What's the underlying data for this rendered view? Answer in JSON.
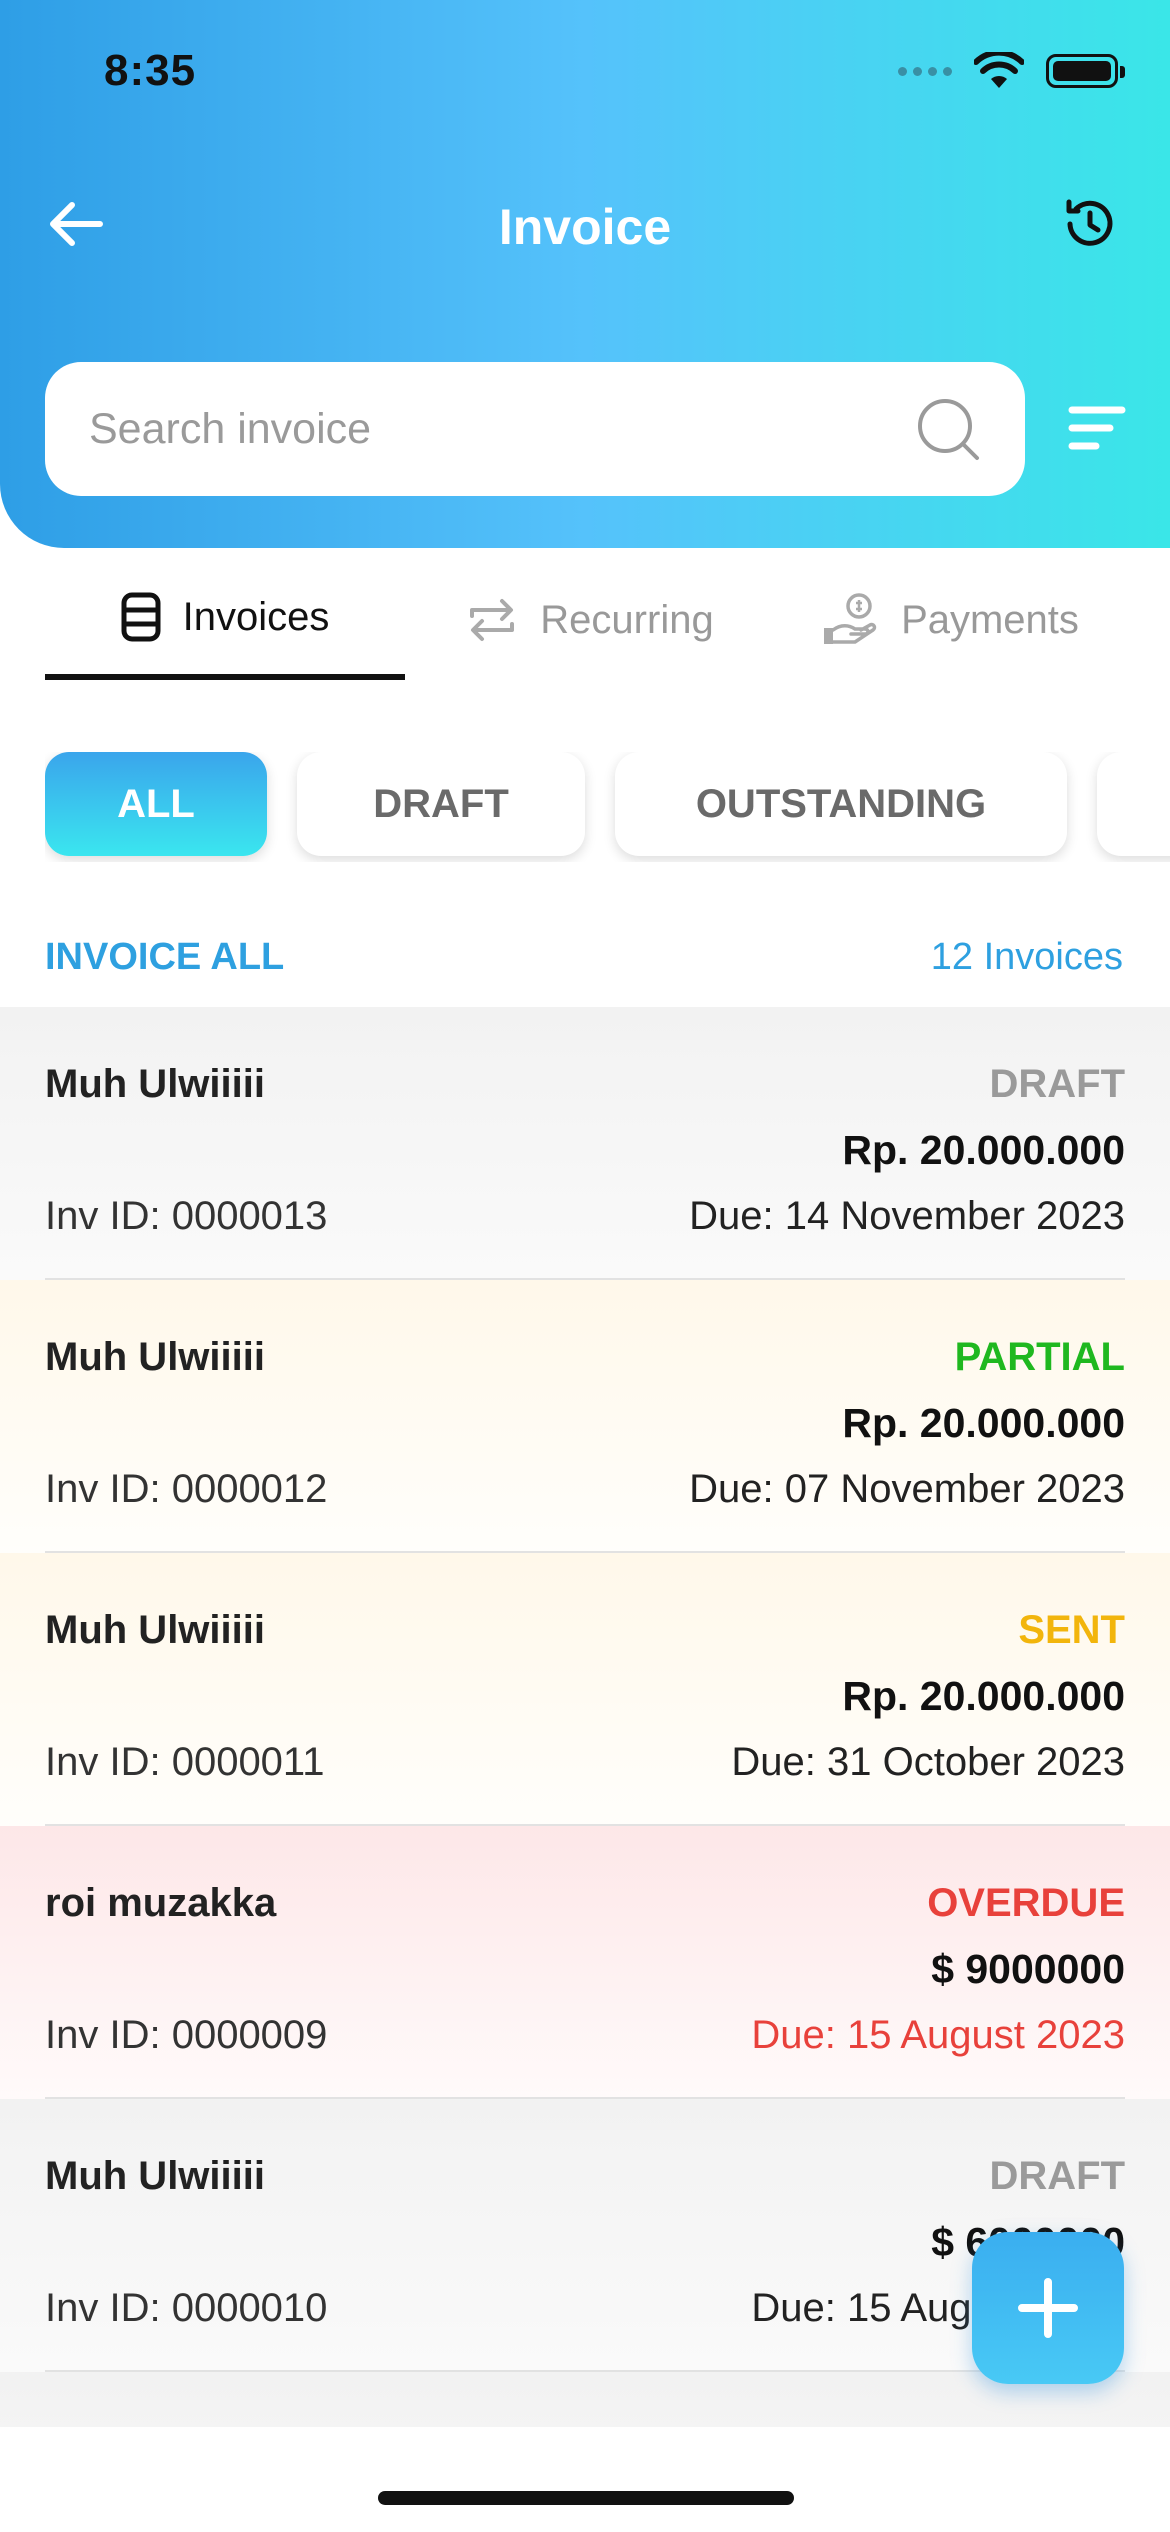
{
  "status_bar": {
    "time": "8:35"
  },
  "header": {
    "title": "Invoice"
  },
  "search": {
    "placeholder": "Search invoice"
  },
  "tabs": [
    {
      "label": "Invoices",
      "icon": "database-icon",
      "active": true
    },
    {
      "label": "Recurring",
      "icon": "repeat-icon",
      "active": false
    },
    {
      "label": "Payments",
      "icon": "hand-coin-icon",
      "active": false
    }
  ],
  "filters": [
    {
      "label": "ALL",
      "active": true
    },
    {
      "label": "DRAFT",
      "active": false
    },
    {
      "label": "OUTSTANDING",
      "active": false
    }
  ],
  "section": {
    "title": "INVOICE ALL",
    "count": "12 Invoices"
  },
  "invoices": [
    {
      "client": "Muh Ulwiiiii",
      "status": "DRAFT",
      "amount": "Rp. 20.000.000",
      "inv_id": "Inv ID: 0000013",
      "due": "Due: 14 November 2023"
    },
    {
      "client": "Muh Ulwiiiii",
      "status": "PARTIAL",
      "amount": "Rp. 20.000.000",
      "inv_id": "Inv ID: 0000012",
      "due": "Due: 07 November 2023"
    },
    {
      "client": "Muh Ulwiiiii",
      "status": "SENT",
      "amount": "Rp. 20.000.000",
      "inv_id": "Inv ID: 0000011",
      "due": "Due: 31 October 2023"
    },
    {
      "client": "roi muzakka",
      "status": "OVERDUE",
      "amount": "$ 9000000",
      "inv_id": "Inv ID: 0000009",
      "due": "Due: 15 August 2023"
    },
    {
      "client": "Muh Ulwiiiii",
      "status": "DRAFT",
      "amount": "$ 6000000",
      "inv_id": "Inv ID: 0000010",
      "due": "Due: 15 August 2023"
    }
  ],
  "colors": {
    "accent": "#2ea0e0",
    "draft": "#9a9a9a",
    "partial": "#1fb81f",
    "sent": "#f2b50c",
    "overdue": "#e8413b"
  }
}
